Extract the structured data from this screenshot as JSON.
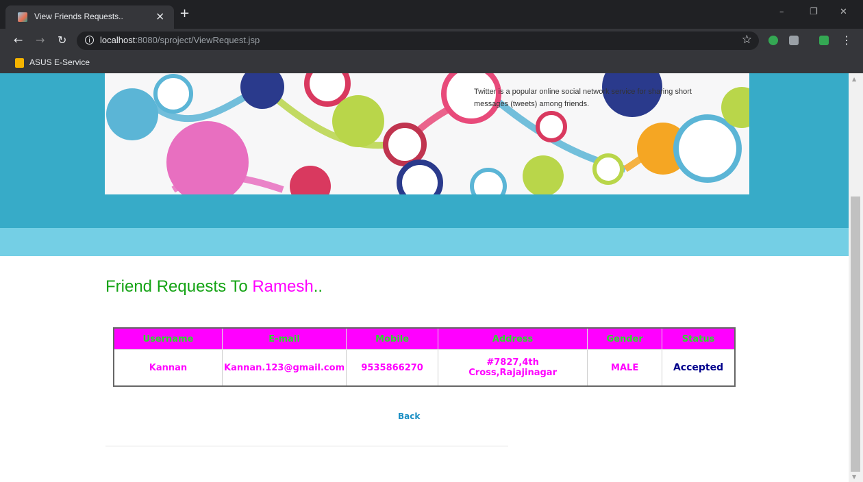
{
  "browser": {
    "tab_title": "View Friends Requests..",
    "tab_close": "×",
    "new_tab": "+",
    "url_host": "localhost",
    "url_rest": ":8080/sproject/ViewRequest.jsp",
    "bookmark": "ASUS E-Service",
    "window_controls": {
      "minimize": "–",
      "maximize": "❐",
      "close": "✕"
    }
  },
  "banner": {
    "text": "Twitter is a popular online social network service for sharing short messages (tweets) among friends."
  },
  "heading": {
    "prefix": "Friend Requests To ",
    "name": "Ramesh",
    "suffix": ".."
  },
  "table": {
    "headers": [
      "Username",
      "E-mail",
      "Mobile",
      "Address",
      "Gender",
      "Status"
    ],
    "rows": [
      {
        "username": "Kannan",
        "email": "Kannan.123@gmail.com",
        "mobile": "9535866270",
        "address": "#7827,4th Cross,Rajajinagar",
        "gender": "MALE",
        "status": "Accepted"
      }
    ]
  },
  "back_link": "Back",
  "colors": {
    "header_teal": "#37abc8",
    "header_light": "#74cfe5",
    "table_header_bg": "#ff00ff",
    "table_header_text": "#2bd92b",
    "heading_green": "#14a314",
    "name_magenta": "#ff00ff",
    "status_text": "#00008b",
    "back_link": "#1a8fc4"
  }
}
